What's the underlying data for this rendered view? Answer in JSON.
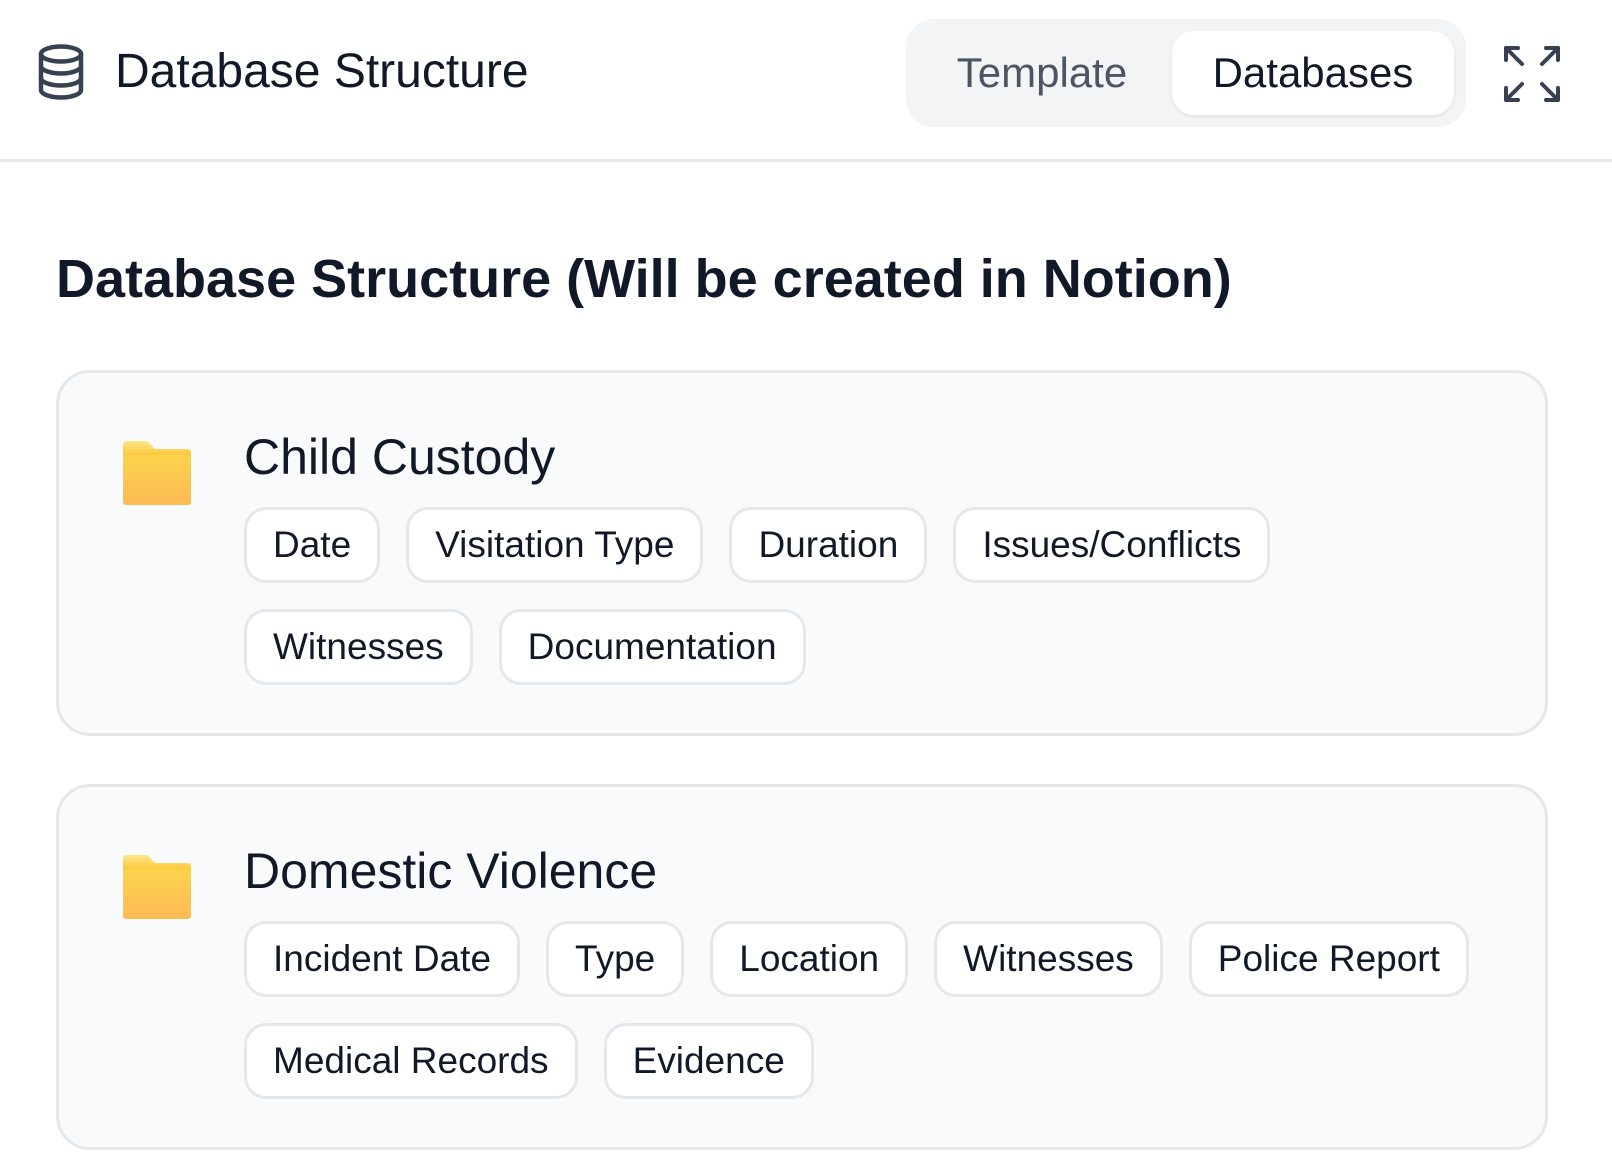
{
  "header": {
    "title": "Database Structure",
    "icon": "database-icon",
    "tabs": [
      {
        "label": "Template",
        "active": false
      },
      {
        "label": "Databases",
        "active": true
      }
    ],
    "expand_icon": "expand-icon"
  },
  "main": {
    "title": "Database Structure (Will be created in Notion)",
    "databases": [
      {
        "name": "Child Custody",
        "icon": "folder-icon",
        "fields": [
          "Date",
          "Visitation Type",
          "Duration",
          "Issues/Conflicts",
          "Witnesses",
          "Documentation"
        ]
      },
      {
        "name": "Domestic Violence",
        "icon": "folder-icon",
        "fields": [
          "Incident Date",
          "Type",
          "Location",
          "Witnesses",
          "Police Report",
          "Medical Records",
          "Evidence"
        ]
      }
    ]
  },
  "colors": {
    "text": "#111827",
    "muted_text": "#4b5563",
    "border": "#e5e7eb",
    "card_bg": "#f9fafb",
    "segment_bg": "#f3f4f6",
    "folder_top": "#fcd34d",
    "folder_bottom": "#fdba54"
  }
}
